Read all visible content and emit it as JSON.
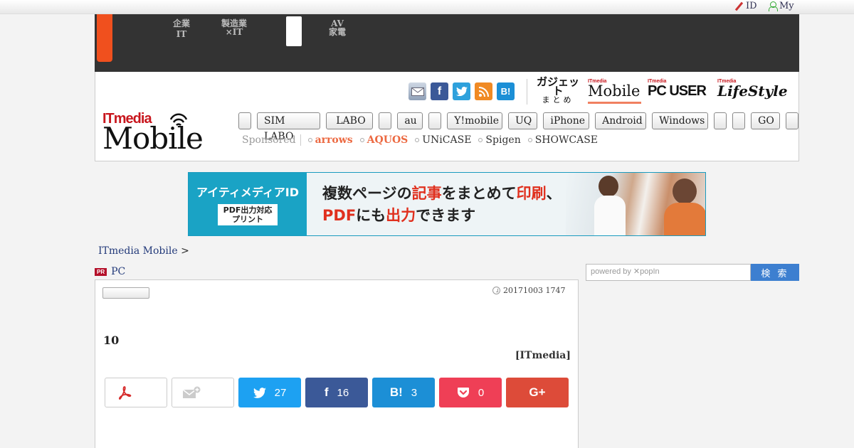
{
  "topbar": {
    "id_label": "ID",
    "my_label": "My"
  },
  "gnav": {
    "items": [
      {
        "line1": "企業",
        "line2": "IT"
      },
      {
        "line1": "製造業",
        "line2": "×IT"
      },
      {
        "line1": "AV",
        "line2": "家電"
      }
    ]
  },
  "header": {
    "logo": {
      "brand": "ITmedia",
      "name": "Mobile"
    },
    "site_switcher": {
      "gadget": {
        "title": "ガジェット",
        "sub": "まとめ"
      },
      "mobile": {
        "small": "ITmedia",
        "name": "Mobile"
      },
      "pcuser": {
        "small": "ITmedia",
        "name": "PC USER"
      },
      "lifestyle": {
        "small": "ITmedia",
        "name": "LifeStyle"
      }
    },
    "social_icons": [
      "mail-icon",
      "facebook-icon",
      "twitter-icon",
      "rss-icon",
      "hatena-bookmark-icon"
    ],
    "category_nav": [
      {
        "label": ""
      },
      {
        "label": "SIM LABO"
      },
      {
        "label": "LABO"
      },
      {
        "label": ""
      },
      {
        "label": "au"
      },
      {
        "label": ""
      },
      {
        "label": "Y!mobile"
      },
      {
        "label": "UQ"
      },
      {
        "label": "iPhone"
      },
      {
        "label": "Android"
      },
      {
        "label": "Windows"
      },
      {
        "label": ""
      },
      {
        "label": ""
      },
      {
        "label": "GO"
      },
      {
        "label": ""
      }
    ],
    "sponsored": {
      "label": "Sponsored",
      "items": [
        "arrows",
        "AQUOS",
        "UNiCASE",
        "Spigen",
        "SHOWCASE"
      ]
    }
  },
  "banner": {
    "brand": "アイティメディアID",
    "badge_line1": "PDF出力対応",
    "badge_line2": "プリント",
    "msg_line1_a": "複数ページの",
    "msg_line1_b": "記事",
    "msg_line1_c": "をまとめて",
    "msg_line1_d": "印刷",
    "msg_line1_e": "、",
    "msg_line2_a": "PDF",
    "msg_line2_b": "にも",
    "msg_line2_c": "出力",
    "msg_line2_d": "できます"
  },
  "breadcrumb": {
    "home": "ITmedia Mobile",
    "sep": ">"
  },
  "pr": {
    "badge": "PR",
    "label": "PC"
  },
  "article": {
    "datetime": "20171003 1747",
    "headline": "10",
    "byline": "[ITmedia]",
    "share": {
      "twitter_count": "27",
      "facebook_count": "16",
      "hatena_count": "3",
      "pocket_count": "0",
      "gplus_label": "G+"
    }
  },
  "search": {
    "placeholder": "powered by ✕popIn",
    "button": "検 索"
  },
  "colors": {
    "accent_orange": "#f0501e",
    "nav_dark": "#333333",
    "twitter": "#1da1f2",
    "facebook": "#3b5998",
    "hatena": "#1c8fd6",
    "pocket": "#ef3f56",
    "gplus": "#dd4b39",
    "search_button": "#3d7fd0"
  }
}
